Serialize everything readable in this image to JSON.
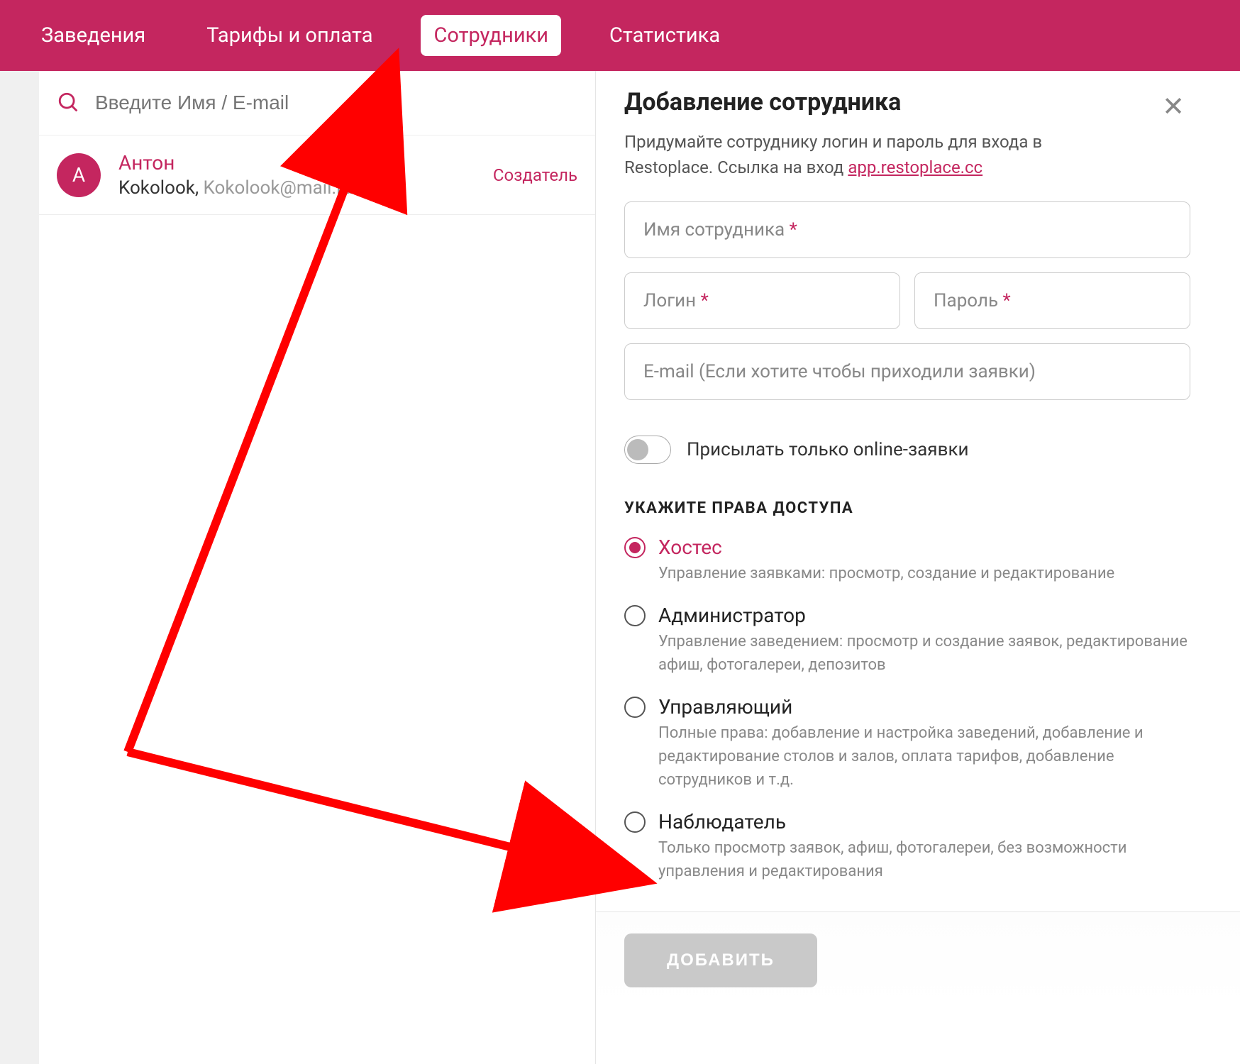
{
  "nav": {
    "items": [
      "Заведения",
      "Тарифы и оплата",
      "Сотрудники",
      "Статистика"
    ],
    "active_index": 2
  },
  "search": {
    "placeholder": "Введите Имя / E-mail"
  },
  "users": [
    {
      "initial": "А",
      "name": "Антон",
      "subPrefix": "Kokolook, ",
      "subEmail": "Kokolook@mail.ru",
      "role": "Создатель"
    }
  ],
  "panel": {
    "title": "Добавление сотрудника",
    "desc_pre": "Придумайте сотруднику логин и пароль для входа в Restoplace. Ссылка на вход ",
    "desc_link": "app.restoplace.cc",
    "fields": {
      "name": "Имя сотрудника",
      "login": "Логин",
      "password": "Пароль",
      "email": "E-mail (Если хотите чтобы приходили заявки)"
    },
    "toggle_label": "Присылать только online-заявки",
    "section": "УКАЖИТЕ ПРАВА ДОСТУПА",
    "roles": [
      {
        "title": "Хостес",
        "desc": "Управление заявками: просмотр, создание и редактирование",
        "selected": true
      },
      {
        "title": "Администратор",
        "desc": "Управление заведением: просмотр и создание заявок, редактирование афиш, фотогалереи, депозитов",
        "selected": false
      },
      {
        "title": "Управляющий",
        "desc": "Полные права: добавление и настройка заведений, добавление и редактирование столов и залов, оплата тарифов, добавление сотрудников и т.д.",
        "selected": false
      },
      {
        "title": "Наблюдатель",
        "desc": "Только просмотр заявок, афиш, фотогалереи, без возможности управления и редактирования",
        "selected": false
      }
    ],
    "submit": "ДОБАВИТЬ"
  }
}
